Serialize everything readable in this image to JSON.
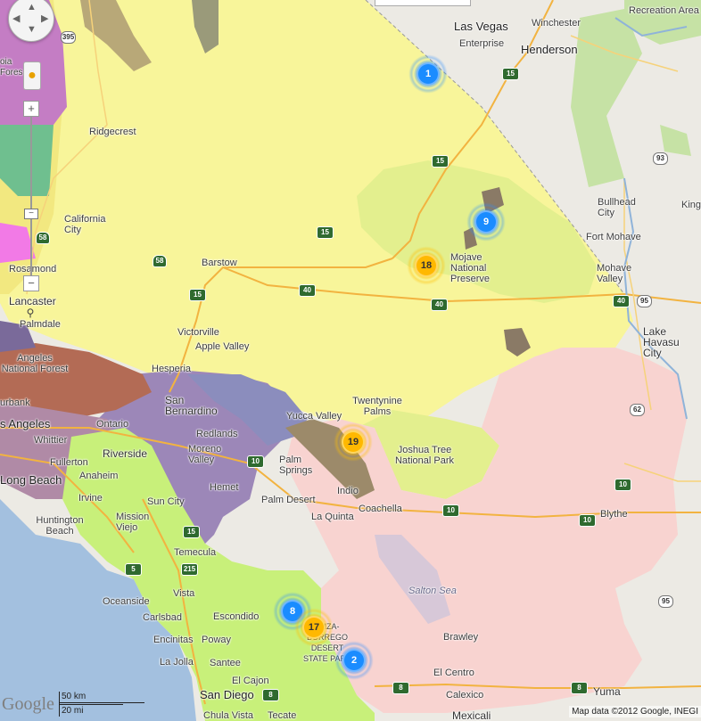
{
  "map": {
    "attribution": "Map data ©2012 Google, INEGI",
    "scale": {
      "km": "50 km",
      "mi": "20 mi"
    },
    "logo": "Google",
    "controls": {
      "zoom_in": "+",
      "zoom_out": "−",
      "slider_knob": "−"
    }
  },
  "places": {
    "las_vegas": "Las Vegas",
    "winchester": "Winchester",
    "enterprise": "Enterprise",
    "henderson": "Henderson",
    "recreation_area": "Recreation Area",
    "ridgecrest": "Ridgecrest",
    "california_city": "California City",
    "rosamond": "Rosamond",
    "lancaster": "Lancaster",
    "palmdale": "Palmdale",
    "barstow": "Barstow",
    "mojave_preserve": "Mojave National Preserve",
    "bullhead_city": "Bullhead City",
    "fort_mohave": "Fort Mohave",
    "mohave_valley": "Mohave Valley",
    "king": "King",
    "lake_havasu": "Lake Havasu City",
    "victorville": "Victorville",
    "apple_valley": "Apple Valley",
    "hesperia": "Hesperia",
    "angeles_nf": "Angeles National Forest",
    "san_bernardino": "San Bernardino",
    "burbank": "urbank",
    "los_angeles": "s Angeles",
    "ontario": "Ontario",
    "whittier": "Whittier",
    "fullerton": "Fullerton",
    "redlands": "Redlands",
    "yucca_valley": "Yucca Valley",
    "twentynine_palms": "Twentynine Palms",
    "joshua_tree": "Joshua Tree National Park",
    "riverside": "Riverside",
    "moreno_valley": "Moreno Valley",
    "long_beach": "Long Beach",
    "anaheim": "Anaheim",
    "irvine": "Irvine",
    "hemet": "Hemet",
    "palm_springs": "Palm Springs",
    "palm_desert": "Palm Desert",
    "indio": "Indio",
    "coachella": "Coachella",
    "la_quinta": "La Quinta",
    "blythe": "Blythe",
    "huntington_beach": "Huntington Beach",
    "mission_viejo": "Mission Viejo",
    "sun_city": "Sun City",
    "temecula": "Temecula",
    "salton_sea": "Salton Sea",
    "oceanside": "Oceanside",
    "vista": "Vista",
    "carlsbad": "Carlsbad",
    "escondido": "Escondido",
    "encinitas": "Encinitas",
    "poway": "Poway",
    "anza_borrego": "ANZA-BORREGO DESERT STATE PARK",
    "brawley": "Brawley",
    "la_jolla": "La Jolla",
    "santee": "Santee",
    "el_centro": "El Centro",
    "el_cajon": "El Cajon",
    "san_diego": "San Diego",
    "calexico": "Calexico",
    "yuma": "Yuma",
    "chula_vista": "Chula Vista",
    "tecate": "Tecate",
    "mexicali": "Mexicali",
    "forest_partial": "oia Fores"
  },
  "shields": [
    "395",
    "15",
    "15",
    "15",
    "58",
    "58",
    "40",
    "40",
    "40",
    "95",
    "93",
    "15",
    "10",
    "10",
    "10",
    "10",
    "15",
    "62",
    "95",
    "8",
    "8",
    "8",
    "5",
    "215"
  ],
  "clusters": [
    {
      "count": "1",
      "color": "blue"
    },
    {
      "count": "9",
      "color": "blue"
    },
    {
      "count": "18",
      "color": "yellow"
    },
    {
      "count": "19",
      "color": "yellow"
    },
    {
      "count": "8",
      "color": "blue"
    },
    {
      "count": "17",
      "color": "yellow"
    },
    {
      "count": "2",
      "color": "blue"
    }
  ],
  "colors": {
    "ocean": "#a3c0df",
    "desert_yellow": "#f8f59a",
    "preserve_green": "#e3ef8e",
    "pink_region": "#f8d3d0",
    "purple_region": "#9c87b8",
    "lime_region": "#c8f07a",
    "brown_region": "#b36b55",
    "cluster_blue": "#1a8cff",
    "cluster_yellow": "#ffb800"
  }
}
